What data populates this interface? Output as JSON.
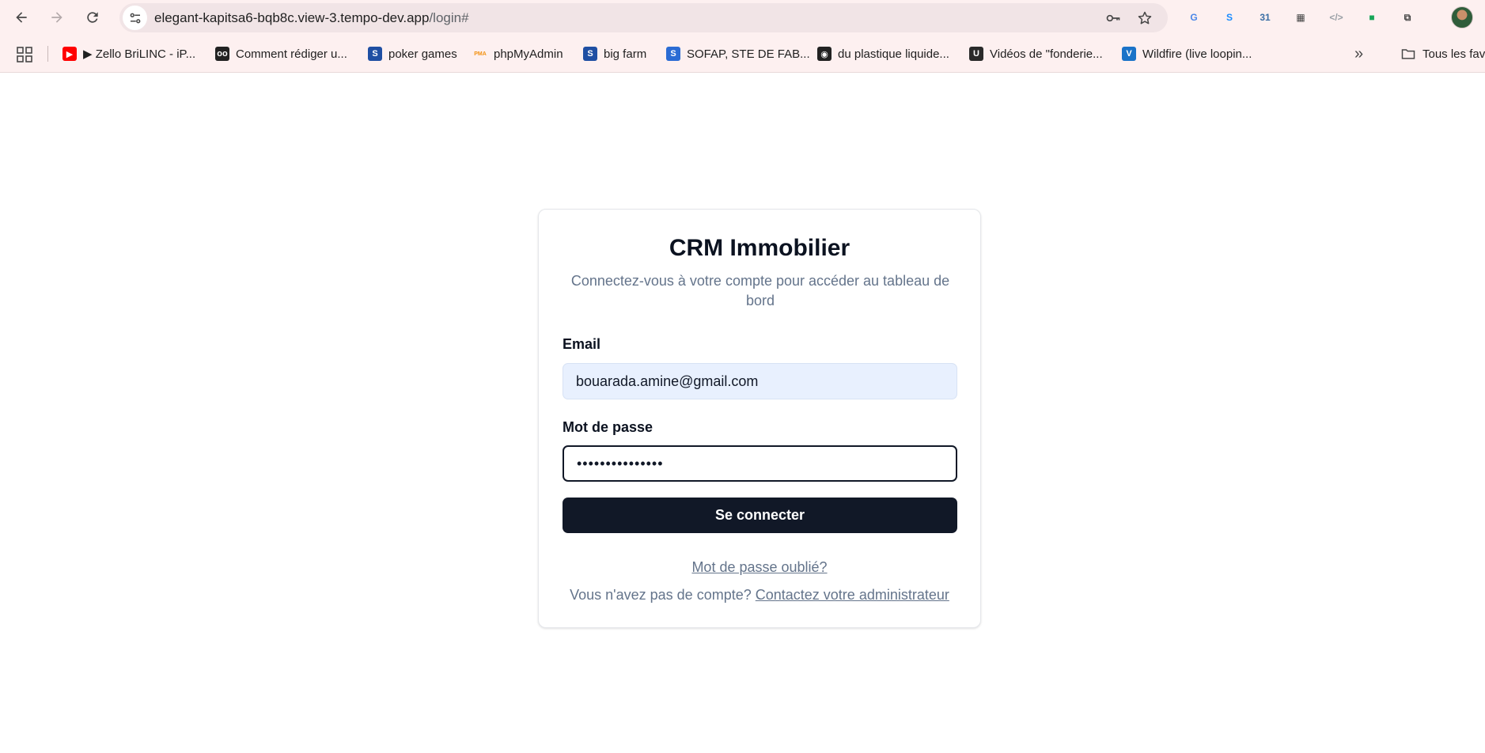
{
  "browser": {
    "url_host": "elegant-kapitsa6-bqb8c.view-3.tempo-dev.app",
    "url_path": "/login#",
    "extensions": [
      {
        "name": "google-translate-icon",
        "label": "G",
        "color": "#4a86e8"
      },
      {
        "name": "shazam-icon",
        "label": "S",
        "color": "#1a8cff"
      },
      {
        "name": "calendar-ext-icon",
        "label": "31",
        "color": "#3a6ea5"
      },
      {
        "name": "qr-code-icon",
        "label": "▦",
        "color": "#444444"
      },
      {
        "name": "code-viewer-icon",
        "label": "</>",
        "color": "#9aa0a6"
      },
      {
        "name": "chat-ext-icon",
        "label": "■",
        "color": "#18a558"
      },
      {
        "name": "extensions-puzzle-icon",
        "label": "⧉",
        "color": "#444444"
      }
    ]
  },
  "bookmarks": {
    "items": [
      {
        "label": "▶ Zello BriLINC - iP...",
        "icon": "youtube-icon",
        "color": "#ff0000",
        "glyph": "▶"
      },
      {
        "label": "Comment rédiger u...",
        "icon": "owl-icon",
        "color": "#222222",
        "glyph": "oo"
      },
      {
        "label": "poker games",
        "icon": "s-brand-icon",
        "color": "#1f4fa3",
        "glyph": "S"
      },
      {
        "label": "phpMyAdmin",
        "icon": "phpmyadmin-icon",
        "color": "#f29111",
        "glyph": "PMA"
      },
      {
        "label": "big farm",
        "icon": "s-brand-icon",
        "color": "#1f4fa3",
        "glyph": "S"
      },
      {
        "label": "SOFAP, STE DE FAB...",
        "icon": "sofap-icon",
        "color": "#2b6cd4",
        "glyph": "S"
      },
      {
        "label": "du plastique liquide...",
        "icon": "vinyl-icon",
        "color": "#222222",
        "glyph": "◉"
      },
      {
        "label": "Vidéos de \"fonderie...",
        "icon": "video-site-icon",
        "color": "#2a2a2a",
        "glyph": "U"
      },
      {
        "label": "Wildfire (live loopin...",
        "icon": "v-brand-icon",
        "color": "#1a73c8",
        "glyph": "V"
      }
    ],
    "folder_label": "Tous les fav"
  },
  "login": {
    "title": "CRM Immobilier",
    "subtitle": "Connectez-vous à votre compte pour accéder au tableau de bord",
    "email_label": "Email",
    "email_value": "bouarada.amine@gmail.com",
    "password_label": "Mot de passe",
    "password_value": "•••••••••••••••",
    "submit_label": "Se connecter",
    "forgot_label": "Mot de passe oublié?",
    "signup_prompt": "Vous n'avez pas de compte?",
    "signup_link": "Contactez votre administrateur"
  }
}
